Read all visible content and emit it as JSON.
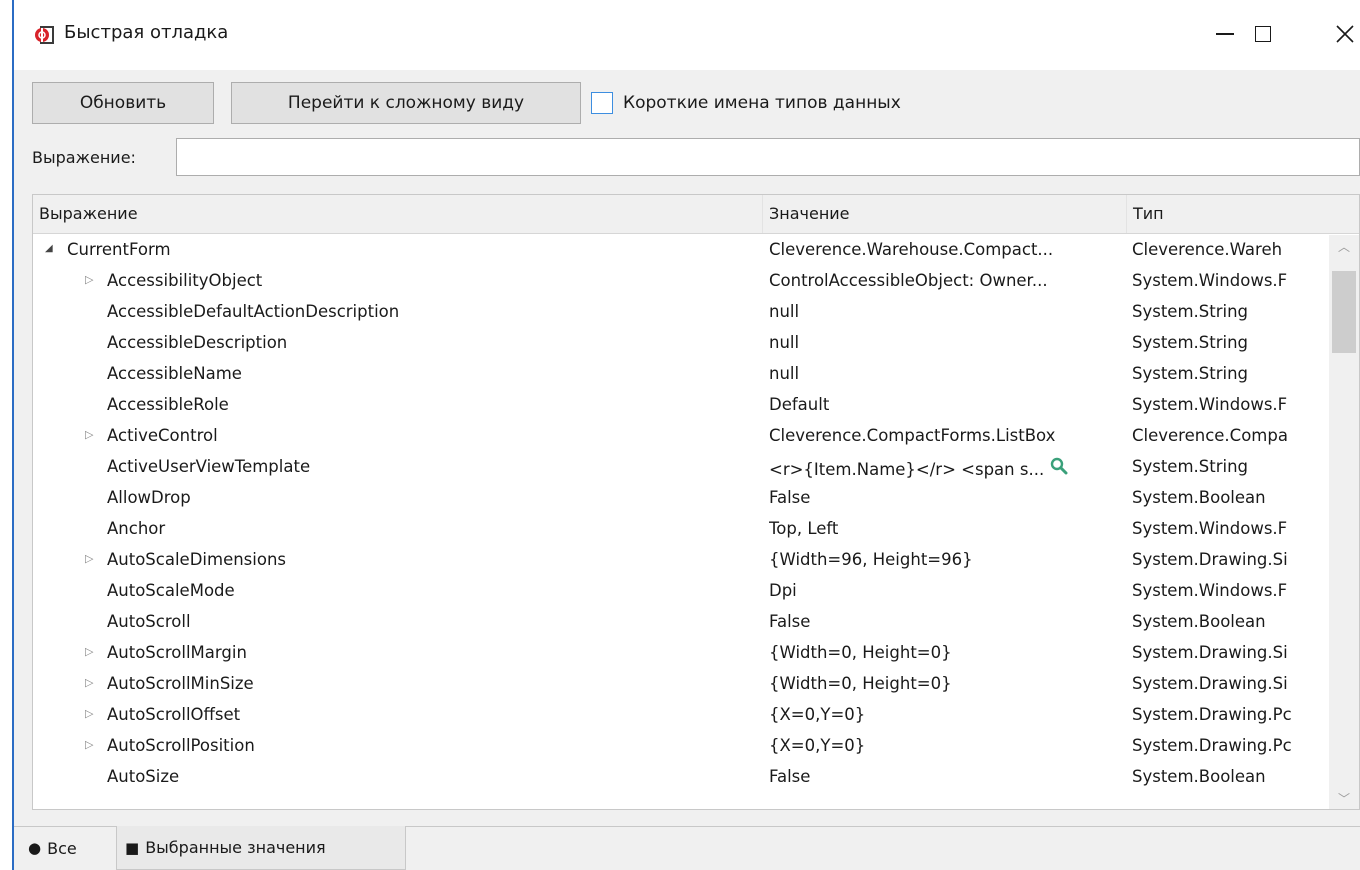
{
  "window": {
    "title": "Быстрая отладка",
    "app_icon": "app-icon",
    "controls": [
      "minimize-icon",
      "maximize-icon",
      "close-icon"
    ]
  },
  "toolbar": {
    "refresh_label": "Обновить",
    "complex_view_label": "Перейти к сложному виду",
    "short_type_names_label": "Короткие имена типов данных",
    "short_type_names_checked": false
  },
  "expression": {
    "label": "Выражение:",
    "value": "",
    "placeholder": ""
  },
  "grid": {
    "columns": [
      "Выражение",
      "Значение",
      "Тип"
    ],
    "rows": [
      {
        "name": "CurrentForm",
        "value": "Cleverence.Warehouse.Compact...",
        "type": "Cleverence.Wareh",
        "level": 0,
        "toggle": "expanded"
      },
      {
        "name": "AccessibilityObject",
        "value": "ControlAccessibleObject: Owner...",
        "type": "System.Windows.F",
        "level": 1,
        "toggle": "collapsed"
      },
      {
        "name": "AccessibleDefaultActionDescription",
        "value": "null",
        "type": "System.String",
        "level": 1,
        "toggle": "none"
      },
      {
        "name": "AccessibleDescription",
        "value": "null",
        "type": "System.String",
        "level": 1,
        "toggle": "none"
      },
      {
        "name": "AccessibleName",
        "value": "null",
        "type": "System.String",
        "level": 1,
        "toggle": "none"
      },
      {
        "name": "AccessibleRole",
        "value": "Default",
        "type": "System.Windows.F",
        "level": 1,
        "toggle": "none"
      },
      {
        "name": "ActiveControl",
        "value": "Cleverence.CompactForms.ListBox",
        "type": "Cleverence.Compa",
        "level": 1,
        "toggle": "collapsed"
      },
      {
        "name": "ActiveUserViewTemplate",
        "value": "<r>{Item.Name}</r> <span s...",
        "type": "System.String",
        "level": 1,
        "toggle": "none",
        "magnifier": true
      },
      {
        "name": "AllowDrop",
        "value": "False",
        "type": "System.Boolean",
        "level": 1,
        "toggle": "none"
      },
      {
        "name": "Anchor",
        "value": "Top, Left",
        "type": "System.Windows.F",
        "level": 1,
        "toggle": "none"
      },
      {
        "name": "AutoScaleDimensions",
        "value": "{Width=96, Height=96}",
        "type": "System.Drawing.Si",
        "level": 1,
        "toggle": "collapsed"
      },
      {
        "name": "AutoScaleMode",
        "value": "Dpi",
        "type": "System.Windows.F",
        "level": 1,
        "toggle": "none"
      },
      {
        "name": "AutoScroll",
        "value": "False",
        "type": "System.Boolean",
        "level": 1,
        "toggle": "none"
      },
      {
        "name": "AutoScrollMargin",
        "value": "{Width=0, Height=0}",
        "type": "System.Drawing.Si",
        "level": 1,
        "toggle": "collapsed"
      },
      {
        "name": "AutoScrollMinSize",
        "value": "{Width=0, Height=0}",
        "type": "System.Drawing.Si",
        "level": 1,
        "toggle": "collapsed"
      },
      {
        "name": "AutoScrollOffset",
        "value": "{X=0,Y=0}",
        "type": "System.Drawing.Pc",
        "level": 1,
        "toggle": "collapsed"
      },
      {
        "name": "AutoScrollPosition",
        "value": "{X=0,Y=0}",
        "type": "System.Drawing.Pc",
        "level": 1,
        "toggle": "collapsed"
      },
      {
        "name": "AutoSize",
        "value": "False",
        "type": "System.Boolean",
        "level": 1,
        "toggle": "none"
      }
    ]
  },
  "tabs": {
    "all_label": "Все",
    "selected_values_label": "Выбранные значения"
  }
}
